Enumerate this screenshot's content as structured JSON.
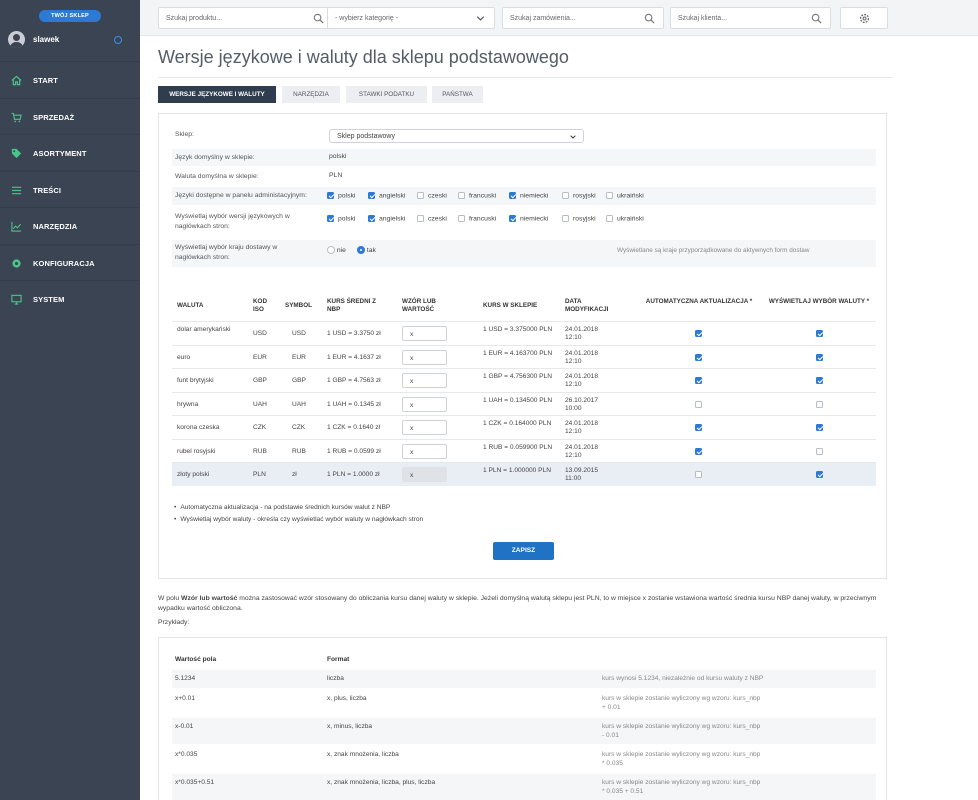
{
  "sidebar": {
    "shop_button": "TWÓJ SKLEP",
    "user_name": "slawek",
    "items": [
      {
        "label": "START",
        "icon": "home-icon"
      },
      {
        "label": "SPRZEDAŻ",
        "icon": "cart-icon"
      },
      {
        "label": "ASORTYMENT",
        "icon": "tag-icon"
      },
      {
        "label": "TREŚCI",
        "icon": "list-icon"
      },
      {
        "label": "NARZĘDZIA",
        "icon": "chart-icon"
      },
      {
        "label": "KONFIGURACJA",
        "icon": "gear-icon"
      },
      {
        "label": "SYSTEM",
        "icon": "monitor-icon"
      }
    ]
  },
  "topbar": {
    "search_product": "Szukaj produktu...",
    "category": "- wybierz kategorię -",
    "search_order": "Szukaj zamówienia...",
    "search_client": "Szukaj klienta..."
  },
  "page": {
    "title": "Wersje językowe i waluty dla sklepu podstawowego",
    "tabs": [
      "WERSJE JĘZYKOWE I WALUTY",
      "NARZĘDZIA",
      "STAWKI PODATKU",
      "PAŃSTWA"
    ]
  },
  "form": {
    "shop_label": "Sklep:",
    "shop_value": "Sklep podstawowy",
    "default_lang_label": "Język domyślny w sklepie:",
    "default_lang_value": "polski",
    "default_currency_label": "Waluta domyślna w sklepie:",
    "default_currency_value": "PLN",
    "admin_langs_label": "Języki dostępne w panelu administacyjnym:",
    "header_langs_label": "Wyświetlaj wybór wersji językowych w nagłówkach stron:",
    "country_label": "Wyświetlaj wybór kraju dostawy w nagłówkach stron:",
    "radio_no": "nie",
    "radio_yes": "tak",
    "country_note": "Wyświetlane są kraje przyporządkowane do aktywnych form dostaw",
    "languages": [
      "polski",
      "angielski",
      "czeski",
      "francuski",
      "niemiecki",
      "rosyjski",
      "ukraiński"
    ],
    "admin_checked": [
      true,
      true,
      false,
      false,
      true,
      false,
      false
    ],
    "header_checked": [
      true,
      true,
      false,
      false,
      true,
      false,
      false
    ]
  },
  "currency_table": {
    "headers": {
      "currency": "WALUTA",
      "iso": "KOD ISO",
      "symbol": "SYMBOL",
      "nbp": "KURS ŚREDNI Z NBP",
      "formula": "WZÓR LUB WARTOŚĆ",
      "shop_rate": "KURS W SKLEPIE",
      "date": "DATA MODYFIKACJI",
      "auto": "AUTOMATYCZNA AKTUALIZACJA *",
      "show": "WYŚWIETLAJ WYBÓR WALUTY *"
    },
    "rows": [
      {
        "name": "dolar amerykański",
        "iso": "USD",
        "symbol": "USD",
        "nbp": "1 USD = 3.3750 zł",
        "formula": "x",
        "shop": "1 USD = 3.375000 PLN",
        "date": "24.01.2018 12:10",
        "auto": true,
        "show": true
      },
      {
        "name": "euro",
        "iso": "EUR",
        "symbol": "EUR",
        "nbp": "1 EUR = 4.1637 zł",
        "formula": "x",
        "shop": "1 EUR = 4.163700 PLN",
        "date": "24.01.2018 12:10",
        "auto": true,
        "show": true
      },
      {
        "name": "funt brytyjski",
        "iso": "GBP",
        "symbol": "GBP",
        "nbp": "1 GBP = 4.7563 zł",
        "formula": "x",
        "shop": "1 GBP = 4.756300 PLN",
        "date": "24.01.2018 12:10",
        "auto": true,
        "show": true
      },
      {
        "name": "hrywna",
        "iso": "UAH",
        "symbol": "UAH",
        "nbp": "1 UAH = 0.1345 zł",
        "formula": "x",
        "shop": "1 UAH = 0.134500 PLN",
        "date": "26.10.2017 10:00",
        "auto": false,
        "show": false
      },
      {
        "name": "korona czeska",
        "iso": "CZK",
        "symbol": "CZK",
        "nbp": "1 CZK = 0.1640 zł",
        "formula": "x",
        "shop": "1 CZK = 0.164000 PLN",
        "date": "24.01.2018 12:10",
        "auto": true,
        "show": true
      },
      {
        "name": "rubel rosyjski",
        "iso": "RUB",
        "symbol": "RUB",
        "nbp": "1 RUB = 0.0599 zł",
        "formula": "x",
        "shop": "1 RUB = 0.059900 PLN",
        "date": "24.01.2018 12:10",
        "auto": true,
        "show": false
      },
      {
        "name": "złoty polski",
        "iso": "PLN",
        "symbol": "zł",
        "nbp": "1 PLN = 1.0000 zł",
        "formula": "x",
        "shop": "1 PLN = 1.000000 PLN",
        "date": "13.09.2015 11:00",
        "auto": false,
        "show": true
      }
    ]
  },
  "notes": [
    "Automatyczna aktualizacja - na podstawie średnich kursów walut z NBP",
    "Wyświetlaj wybór waluty - określa czy wyświetlać wybór waluty w nagłówkach stron"
  ],
  "save_label": "ZAPISZ",
  "explain": {
    "prefix": "W polu ",
    "bold": "Wzór lub wartość",
    "suffix": " można zastosować wzór stosowany do obliczania kursu danej waluty w sklepie. Jeżeli domyślną walutą sklepu jest PLN, to w miejsce x zostanie wstawiona wartość średnia kursu NBP danej waluty, w przeciwnym wypadku wartość obliczona.",
    "examples_label": "Przykłady:"
  },
  "examples": {
    "header_value": "Wartość pola",
    "header_format": "Format",
    "rows": [
      {
        "value": "5.1234",
        "format": "liczba",
        "desc": "kurs wynosi 5.1234, niezależnie od kursu waluty z NBP"
      },
      {
        "value": "x+0.01",
        "format": "x, plus, liczba",
        "desc": "kurs w sklepie zostanie wyliczony wg wzoru: kurs_nbp + 0.01"
      },
      {
        "value": "x-0.01",
        "format": "x, minus, liczba",
        "desc": "kurs w sklepie zostanie wyliczony wg wzoru: kurs_nbp - 0.01"
      },
      {
        "value": "x*0.035",
        "format": "x, znak mnożenia, liczba",
        "desc": "kurs w sklepie zostanie wyliczony wg wzoru: kurs_nbp * 0.035"
      },
      {
        "value": "x*0.035+0.51",
        "format": "x, znak mnożenia, liczba, plus, liczba",
        "desc": "kurs w sklepie zostanie wyliczony wg wzoru: kurs_nbp * 0.035 + 0.51"
      }
    ]
  },
  "colors": {
    "sidebar_bg": "#3b4452",
    "accent": "#2d7ad4",
    "active_tab": "#2f3d4e",
    "save_button": "#1f72c4"
  }
}
